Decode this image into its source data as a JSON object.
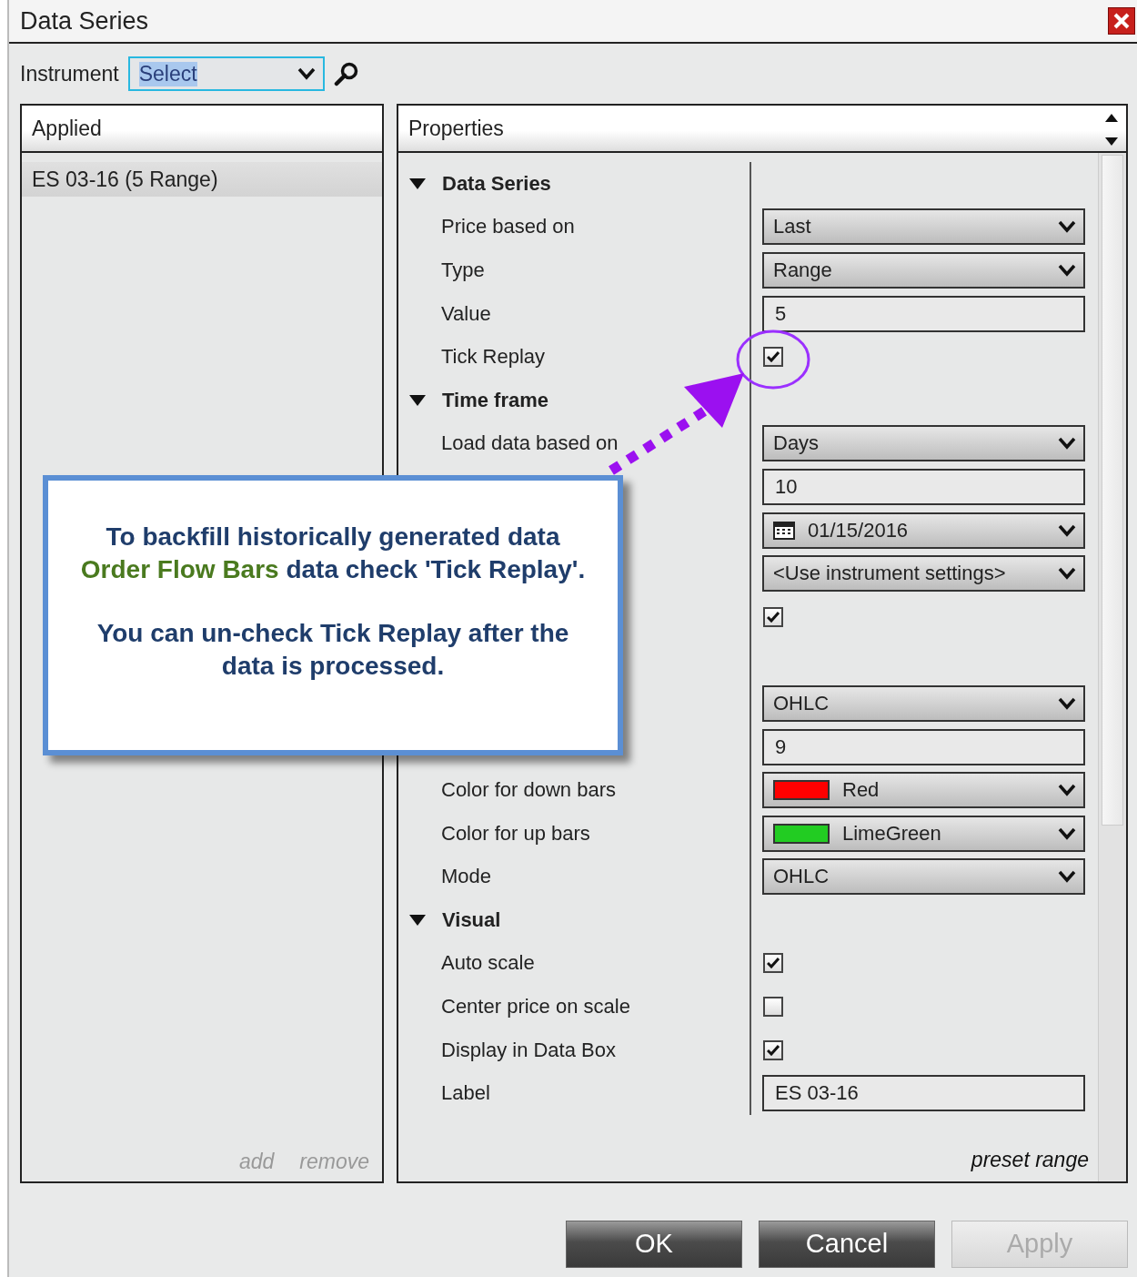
{
  "window": {
    "title": "Data Series"
  },
  "instrument": {
    "label": "Instrument",
    "value": "Select"
  },
  "applied": {
    "header": "Applied",
    "items": [
      {
        "label": "ES 03-16 (5 Range)",
        "selected": true
      }
    ],
    "links": [
      "add",
      "remove"
    ]
  },
  "properties": {
    "header": "Properties",
    "footer_link": "preset range",
    "rows": [
      {
        "kind": "category",
        "label": "Data Series",
        "expanded": true
      },
      {
        "kind": "dropdown",
        "label": "Price based on",
        "value": "Last"
      },
      {
        "kind": "dropdown",
        "label": "Type",
        "value": "Range"
      },
      {
        "kind": "text",
        "label": "Value",
        "value": "5"
      },
      {
        "kind": "checkbox",
        "label": "Tick Replay",
        "checked": true
      },
      {
        "kind": "category",
        "label": "Time frame",
        "expanded": true
      },
      {
        "kind": "dropdown",
        "label": "Load data based on",
        "value": "Days"
      },
      {
        "kind": "text",
        "value": "10"
      },
      {
        "kind": "date",
        "value": "01/15/2016"
      },
      {
        "kind": "dropdown",
        "value": "<Use instrument settings>"
      },
      {
        "kind": "checkbox",
        "checked": true
      },
      {
        "kind": "spacer"
      },
      {
        "kind": "dropdown",
        "value": "OHLC"
      },
      {
        "kind": "text",
        "value": "9"
      },
      {
        "kind": "color",
        "label": "Color for down bars",
        "value": "Red",
        "color": "#ff0000"
      },
      {
        "kind": "color",
        "label": "Color for up bars",
        "value": "LimeGreen",
        "color": "#22cc22"
      },
      {
        "kind": "dropdown",
        "label": "Mode",
        "value": "OHLC"
      },
      {
        "kind": "category",
        "label": "Visual",
        "expanded": true
      },
      {
        "kind": "checkbox",
        "label": "Auto scale",
        "checked": true
      },
      {
        "kind": "checkbox",
        "label": "Center price on scale",
        "checked": false
      },
      {
        "kind": "checkbox",
        "label": "Display in Data Box",
        "checked": true
      },
      {
        "kind": "text",
        "label": "Label",
        "value": "ES 03-16"
      }
    ]
  },
  "callout": {
    "paragraphs": [
      [
        "To backfill historically generated data",
        "**Order Flow Bars** data check 'Tick Replay'."
      ],
      [
        "You can un-check Tick Replay after the",
        "data is processed."
      ]
    ]
  },
  "buttons": [
    {
      "label": "OK",
      "disabled": false
    },
    {
      "label": "Cancel",
      "disabled": false
    },
    {
      "label": "Apply",
      "disabled": true
    }
  ]
}
